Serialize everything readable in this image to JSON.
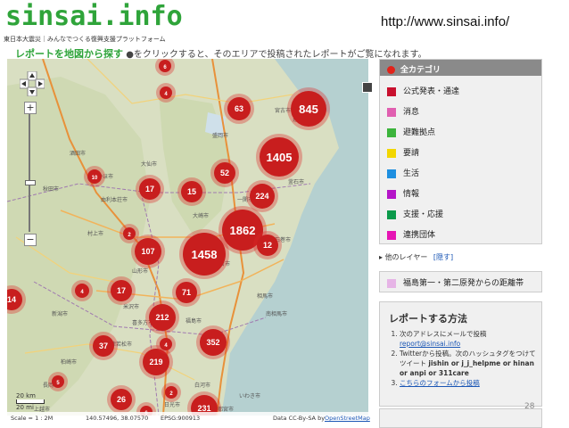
{
  "header": {
    "logo": "sinsai.info",
    "logo_sub": "東日本大震災｜みんなでつくる復興支援プラットフォーム",
    "url": "http://www.sinsai.info/"
  },
  "instruction": {
    "lead": "レポートを地図から探す",
    "text": "●をクリックすると、そのエリアで投稿されたレポートがご覧になれます。"
  },
  "map": {
    "clusters": [
      "845",
      "63",
      "4",
      "6",
      "1405",
      "52",
      "10",
      "17",
      "15",
      "224",
      "1862",
      "2",
      "12",
      "107",
      "1458",
      "4",
      "17",
      "71",
      "212",
      "352",
      "37",
      "219",
      "5",
      "26",
      "2",
      "231",
      "14",
      "4",
      "6"
    ],
    "towns": [
      "秋田市",
      "盛岡市",
      "釜石市",
      "山形市",
      "仙台市",
      "石巻市",
      "福島市",
      "郡山市",
      "いわき市",
      "会津若松市",
      "新潟市",
      "大崎市",
      "米沢市",
      "長岡市",
      "遠野市",
      "宮古市",
      "酒田市",
      "にかほ市",
      "由利本荘市",
      "大仙市",
      "一関市",
      "上越市",
      "柏崎市",
      "村上市",
      "喜多方市",
      "相馬市",
      "南相馬市",
      "白河市",
      "日光市",
      "宇都宮市"
    ],
    "scale_label": "20 km",
    "scale_label2": "20 mi",
    "footer_scale": "Scale = 1 : 2M",
    "footer_coords": "140.57496, 38.07570",
    "footer_epsg": "EPSG:900913",
    "footer_attr": "Data CC-By-SA by",
    "footer_link": "OpenStreetMap"
  },
  "categories": {
    "all": "全カテゴリ",
    "items": [
      {
        "label": "公式発表・通達",
        "color": "#c8102e"
      },
      {
        "label": "消息",
        "color": "#e05fb0"
      },
      {
        "label": "避難拠点",
        "color": "#3cb43c"
      },
      {
        "label": "要請",
        "color": "#f2d600"
      },
      {
        "label": "生活",
        "color": "#1e8fe0"
      },
      {
        "label": "情報",
        "color": "#b414c8"
      },
      {
        "label": "支援・応援",
        "color": "#0a9a4a"
      },
      {
        "label": "連携団体",
        "color": "#e614b4"
      }
    ]
  },
  "layers": {
    "title": "他のレイヤー",
    "toggle": "[隠す]",
    "distance": "福島第一・第二原発からの距離帯"
  },
  "report": {
    "title": "レポートする方法",
    "step1_text": "次のアドレスにメールで投稿",
    "step1_email": "report@sinsai.info",
    "step2_text": "Twitterから投稿。次のハッシュタグをつけてツイート",
    "step2_tags": "jishin or j_j_helpme or hinan or anpi or 311care",
    "step3_link": "こちらのフォームから投稿"
  },
  "page_number": "28"
}
